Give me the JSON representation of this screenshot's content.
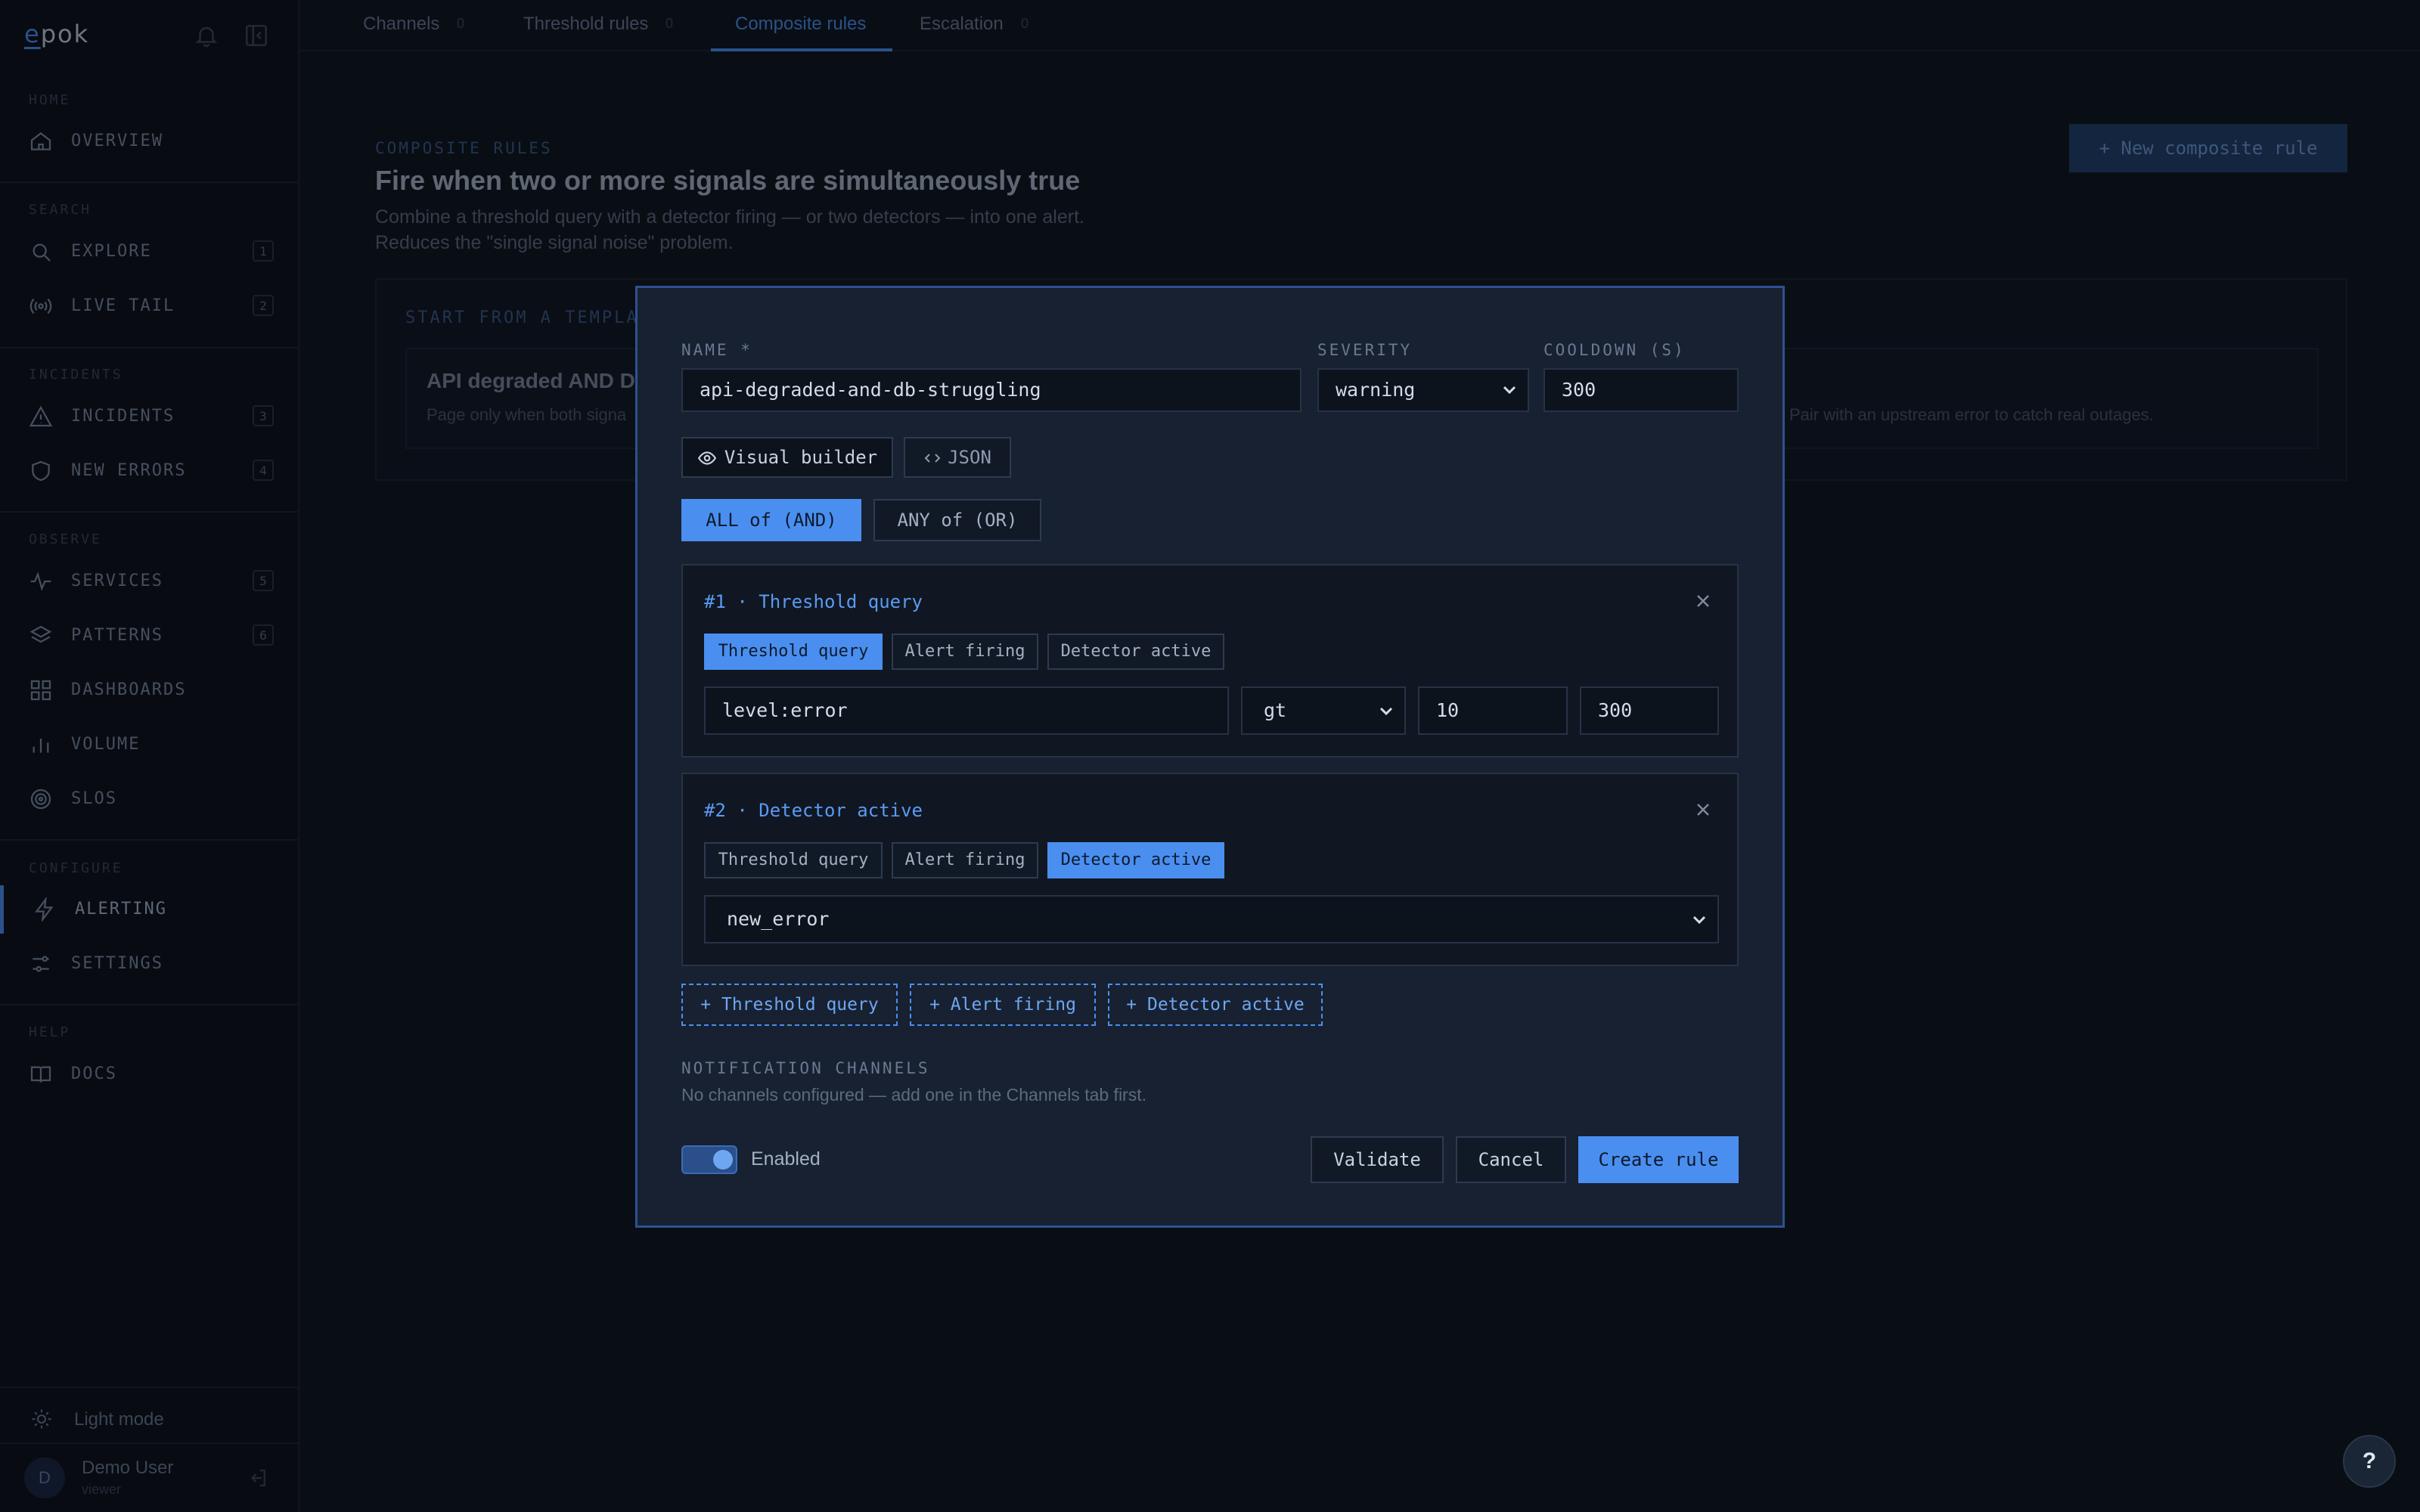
{
  "sidebar": {
    "logo_e": "e",
    "logo_rest": "pok",
    "sections": {
      "home": "HOME",
      "search": "SEARCH",
      "incidents": "INCIDENTS",
      "observe": "OBSERVE",
      "configure": "CONFIGURE",
      "help": "HELP"
    },
    "items": {
      "overview": {
        "label": "OVERVIEW",
        "icon": "home-icon"
      },
      "explore": {
        "label": "EXPLORE",
        "badge": "1",
        "icon": "search-icon"
      },
      "live_tail": {
        "label": "LIVE TAIL",
        "badge": "2",
        "icon": "broadcast-icon"
      },
      "incidents": {
        "label": "INCIDENTS",
        "badge": "3",
        "icon": "warning-icon"
      },
      "new_errors": {
        "label": "NEW ERRORS",
        "badge": "4",
        "icon": "shield-icon"
      },
      "services": {
        "label": "SERVICES",
        "badge": "5",
        "icon": "pulse-icon"
      },
      "patterns": {
        "label": "PATTERNS",
        "badge": "6",
        "icon": "layers-icon"
      },
      "dashboards": {
        "label": "DASHBOARDS",
        "icon": "grid-icon"
      },
      "volume": {
        "label": "VOLUME",
        "icon": "bar-chart-icon"
      },
      "slos": {
        "label": "SLOS",
        "icon": "target-icon"
      },
      "alerting": {
        "label": "ALERTING",
        "icon": "bolt-icon"
      },
      "settings": {
        "label": "SETTINGS",
        "icon": "sliders-icon"
      },
      "docs": {
        "label": "DOCS",
        "icon": "book-icon"
      }
    },
    "light_mode": "Light mode",
    "user": {
      "initial": "D",
      "name": "Demo User",
      "role": "viewer"
    }
  },
  "tabs": [
    {
      "label": "Channels",
      "count": "0"
    },
    {
      "label": "Threshold rules",
      "count": "0"
    },
    {
      "label": "Composite rules",
      "count": ""
    },
    {
      "label": "Escalation",
      "count": "0"
    }
  ],
  "page": {
    "kicker": "COMPOSITE RULES",
    "title": "Fire when two or more signals are simultaneously true",
    "description": "Combine a threshold query with a detector firing — or two detectors — into one alert. Reduces the \"single signal noise\" problem.",
    "new_button": "+ New composite rule",
    "templates_label": "START FROM A TEMPLATE",
    "template_title": "API degraded AND DB",
    "template_sub": "Page only when both signa",
    "template_sub2": "Pair with an upstream error to catch real outages."
  },
  "modal": {
    "name_label": "NAME",
    "name_required": "*",
    "name_value": "api-degraded-and-db-struggling",
    "severity_label": "SEVERITY",
    "severity_value": "warning",
    "cooldown_label": "COOLDOWN (S)",
    "cooldown_value": "300",
    "mode_visual": "Visual builder",
    "mode_json": "JSON",
    "combinator_all": "ALL of (AND)",
    "combinator_any": "ANY of (OR)",
    "condition_types": [
      "Threshold query",
      "Alert firing",
      "Detector active"
    ],
    "conditions": [
      {
        "title": "#1 · Threshold query",
        "query": "level:error",
        "operator": "gt",
        "threshold": "10",
        "window": "300"
      },
      {
        "title": "#2 · Detector active",
        "detector": "new_error"
      }
    ],
    "add_buttons": [
      "+ Threshold query",
      "+ Alert firing",
      "+ Detector active"
    ],
    "channels_label": "NOTIFICATION CHANNELS",
    "channels_empty": "No channels configured — add one in the Channels tab first.",
    "enabled_label": "Enabled",
    "enabled": true,
    "validate": "Validate",
    "cancel": "Cancel",
    "create": "Create rule"
  },
  "help_button": "?",
  "colors": {
    "accent": "#4a8ff0",
    "background": "#0e141e",
    "modal": "#172131"
  }
}
